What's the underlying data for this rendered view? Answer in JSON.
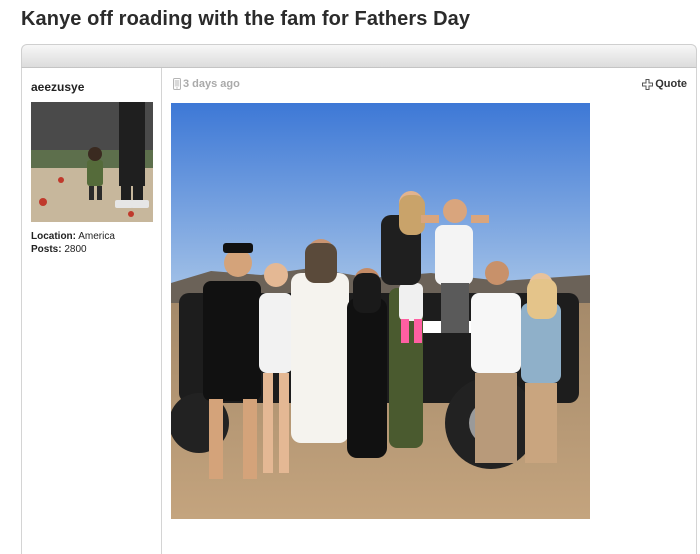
{
  "thread": {
    "title": "Kanye off roading with the fam for Fathers Day"
  },
  "post": {
    "username": "aeezusye",
    "location_label": "Location:",
    "location_value": "America",
    "posts_label": "Posts:",
    "posts_value": "2800",
    "time_ago": "3 days ago",
    "quote_label": "Quote"
  },
  "icons": {
    "mobile": "mobile-phone-icon",
    "quote": "quote-plus-icon"
  },
  "colors": {
    "sky": "#4f86d8",
    "ground": "#b59470",
    "title": "#2b2b2b",
    "meta_grey": "#aaaaaa"
  }
}
